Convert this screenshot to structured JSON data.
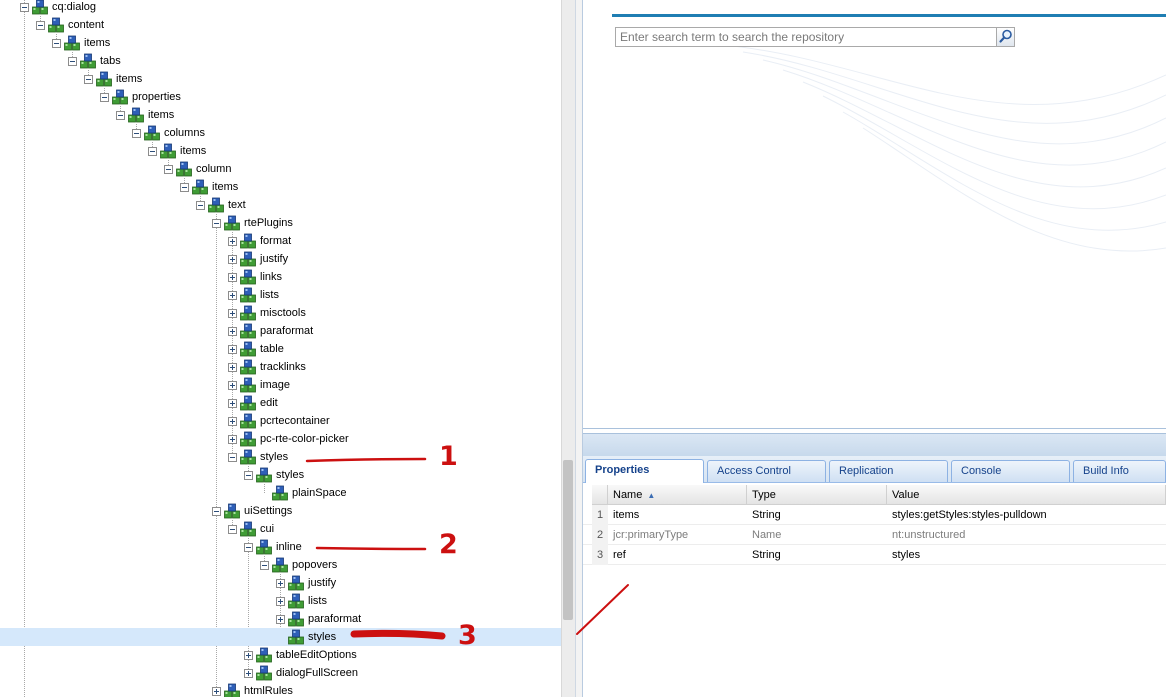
{
  "tree": {
    "nodes": [
      {
        "label": "cq:dialog",
        "depth": 1,
        "toggle": "minus"
      },
      {
        "label": "content",
        "depth": 2,
        "toggle": "minus"
      },
      {
        "label": "items",
        "depth": 3,
        "toggle": "minus"
      },
      {
        "label": "tabs",
        "depth": 4,
        "toggle": "minus"
      },
      {
        "label": "items",
        "depth": 5,
        "toggle": "minus"
      },
      {
        "label": "properties",
        "depth": 6,
        "toggle": "minus"
      },
      {
        "label": "items",
        "depth": 7,
        "toggle": "minus"
      },
      {
        "label": "columns",
        "depth": 8,
        "toggle": "minus"
      },
      {
        "label": "items",
        "depth": 9,
        "toggle": "minus"
      },
      {
        "label": "column",
        "depth": 10,
        "toggle": "minus"
      },
      {
        "label": "items",
        "depth": 11,
        "toggle": "minus"
      },
      {
        "label": "text",
        "depth": 12,
        "toggle": "minus"
      },
      {
        "label": "rtePlugins",
        "depth": 13,
        "toggle": "minus"
      },
      {
        "label": "format",
        "depth": 14,
        "toggle": "plus"
      },
      {
        "label": "justify",
        "depth": 14,
        "toggle": "plus"
      },
      {
        "label": "links",
        "depth": 14,
        "toggle": "plus"
      },
      {
        "label": "lists",
        "depth": 14,
        "toggle": "plus"
      },
      {
        "label": "misctools",
        "depth": 14,
        "toggle": "plus"
      },
      {
        "label": "paraformat",
        "depth": 14,
        "toggle": "plus"
      },
      {
        "label": "table",
        "depth": 14,
        "toggle": "plus"
      },
      {
        "label": "tracklinks",
        "depth": 14,
        "toggle": "plus"
      },
      {
        "label": "image",
        "depth": 14,
        "toggle": "plus"
      },
      {
        "label": "edit",
        "depth": 14,
        "toggle": "plus"
      },
      {
        "label": "pcrtecontainer",
        "depth": 14,
        "toggle": "plus"
      },
      {
        "label": "pc-rte-color-picker",
        "depth": 14,
        "toggle": "plus"
      },
      {
        "label": "styles",
        "depth": 14,
        "toggle": "minus"
      },
      {
        "label": "styles",
        "depth": 15,
        "toggle": "minus"
      },
      {
        "label": "plainSpace",
        "depth": 16,
        "toggle": "none"
      },
      {
        "label": "uiSettings",
        "depth": 13,
        "toggle": "minus"
      },
      {
        "label": "cui",
        "depth": 14,
        "toggle": "minus"
      },
      {
        "label": "inline",
        "depth": 15,
        "toggle": "minus"
      },
      {
        "label": "popovers",
        "depth": 16,
        "toggle": "minus"
      },
      {
        "label": "justify",
        "depth": 17,
        "toggle": "plus"
      },
      {
        "label": "lists",
        "depth": 17,
        "toggle": "plus"
      },
      {
        "label": "paraformat",
        "depth": 17,
        "toggle": "plus"
      },
      {
        "label": "styles",
        "depth": 17,
        "toggle": "none",
        "selected": true
      },
      {
        "label": "tableEditOptions",
        "depth": 15,
        "toggle": "plus"
      },
      {
        "label": "dialogFullScreen",
        "depth": 15,
        "toggle": "plus"
      },
      {
        "label": "htmlRules",
        "depth": 13,
        "toggle": "plus"
      }
    ]
  },
  "search": {
    "placeholder": "Enter search term to search the repository",
    "button_icon": "magnifier-icon"
  },
  "properties_panel": {
    "tabs": [
      {
        "label": "Properties",
        "active": true
      },
      {
        "label": "Access Control",
        "active": false
      },
      {
        "label": "Replication",
        "active": false
      },
      {
        "label": "Console",
        "active": false
      },
      {
        "label": "Build Info",
        "active": false
      }
    ],
    "columns": {
      "name": "Name",
      "type": "Type",
      "value": "Value",
      "sort_indicator": "▲"
    },
    "rows": [
      {
        "num": "1",
        "name": "items",
        "type": "String",
        "value": "styles:getStyles:styles-pulldown",
        "dim": false
      },
      {
        "num": "2",
        "name": "jcr:primaryType",
        "type": "Name",
        "value": "nt:unstructured",
        "dim": true
      },
      {
        "num": "3",
        "name": "ref",
        "type": "String",
        "value": "styles",
        "dim": false
      }
    ]
  },
  "annotations": {
    "marks": [
      {
        "label": "1"
      },
      {
        "label": "2"
      },
      {
        "label": "3"
      }
    ],
    "color": "#cc1010"
  },
  "colors": {
    "accent": "#1f7eb3",
    "tab_text": "#15428b",
    "selection": "#d5e8fb"
  }
}
